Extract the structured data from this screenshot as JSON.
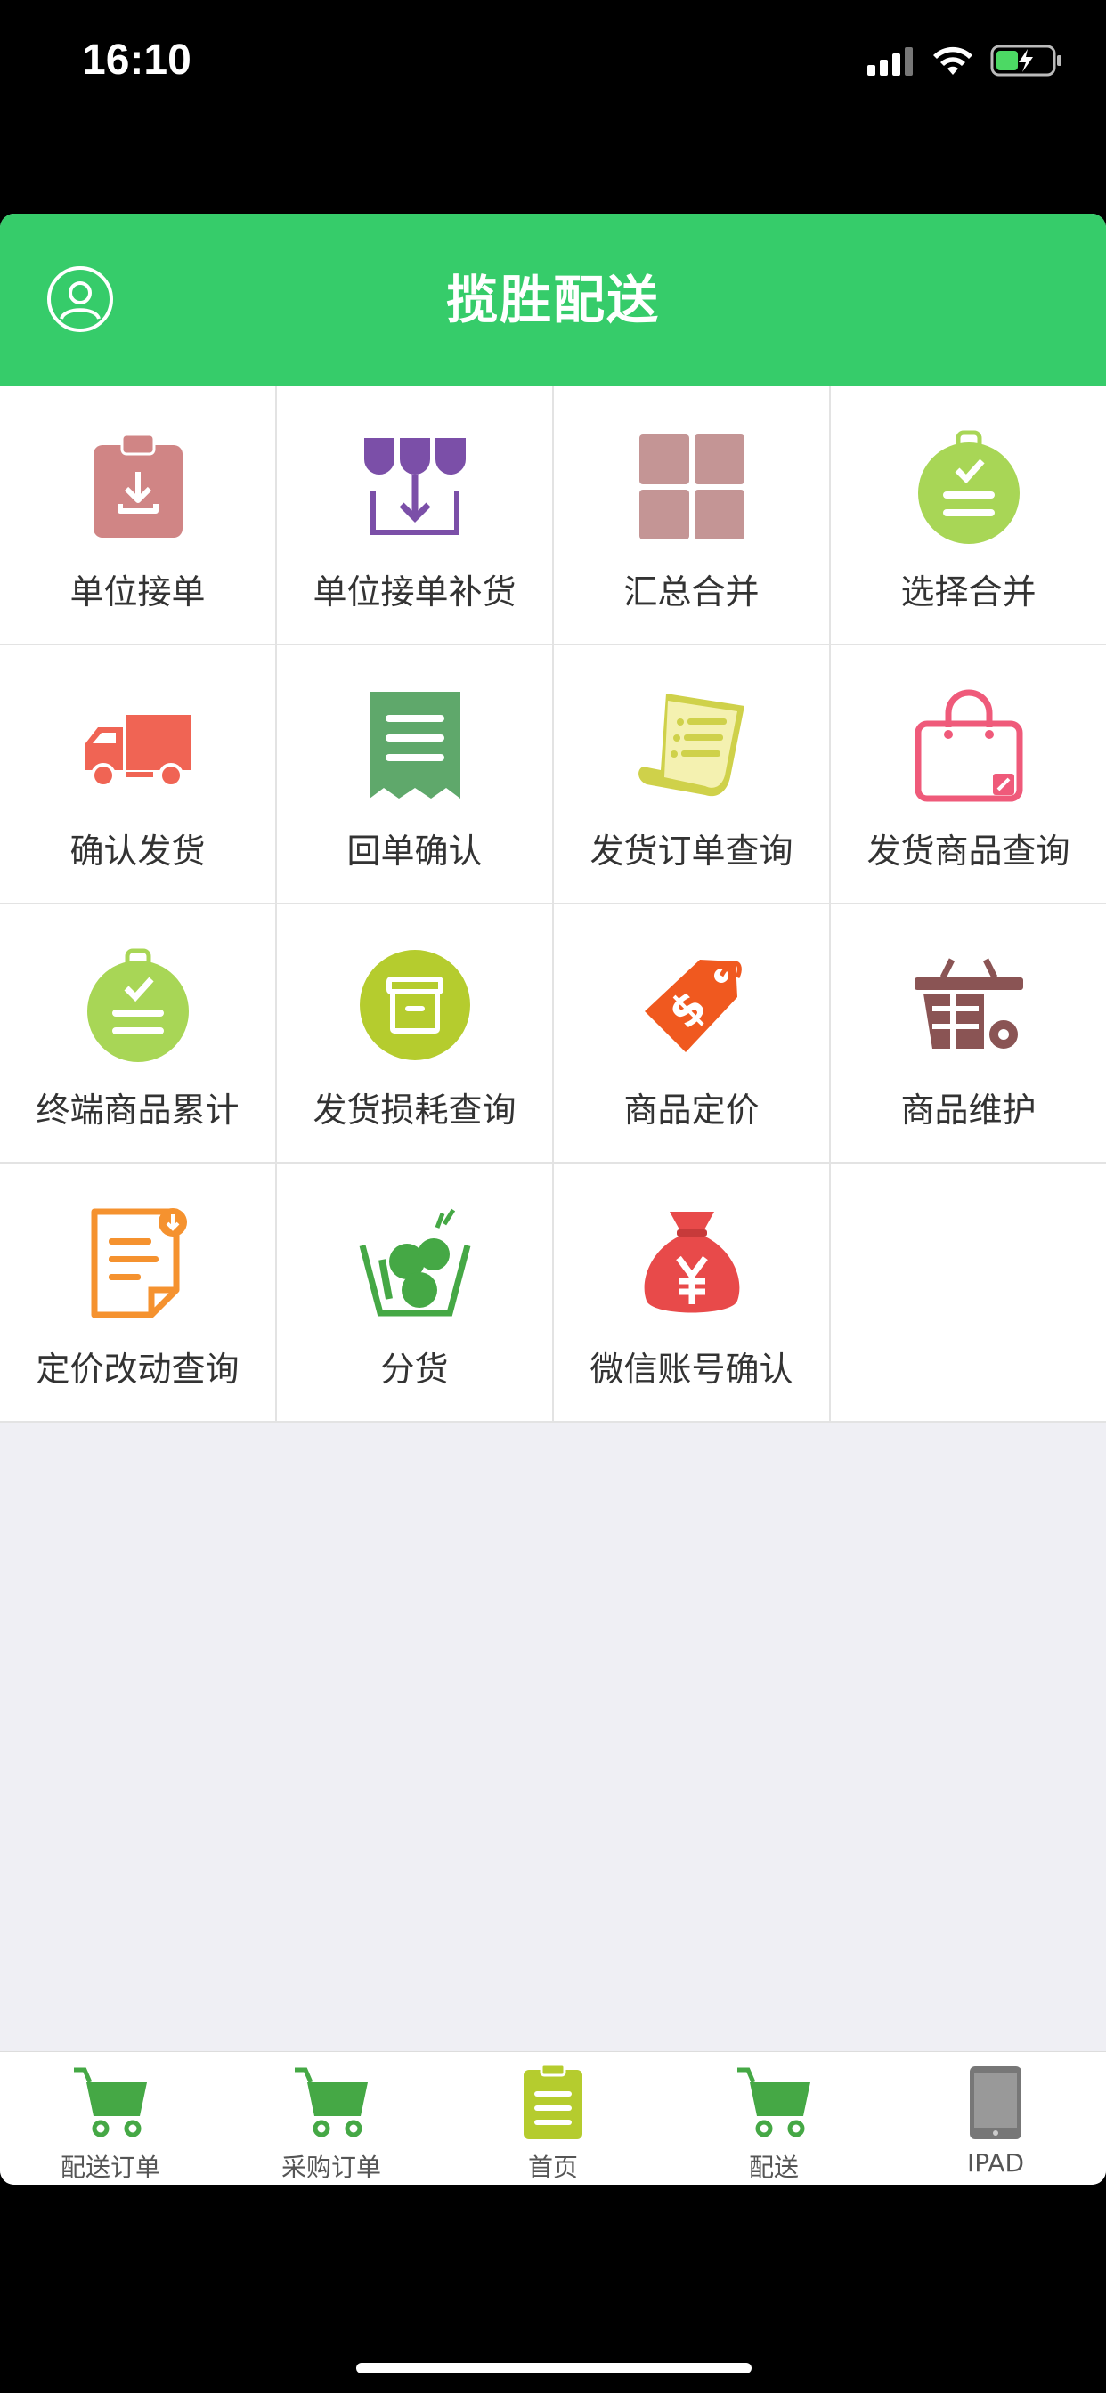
{
  "status_bar": {
    "time": "16:10"
  },
  "header": {
    "title": "揽胜配送"
  },
  "grid": [
    {
      "label": "单位接单",
      "icon": "clipboard-download-icon",
      "color": "#d08585"
    },
    {
      "label": "单位接单补货",
      "icon": "awning-arrow-down-icon",
      "color": "#7b4fa8"
    },
    {
      "label": "汇总合并",
      "icon": "four-squares-icon",
      "color": "#c49595"
    },
    {
      "label": "选择合并",
      "icon": "tag-check-icon",
      "color": "#a8d656"
    },
    {
      "label": "确认发货",
      "icon": "delivery-truck-icon",
      "color": "#f06454"
    },
    {
      "label": "回单确认",
      "icon": "receipt-icon",
      "color": "#5fa86b"
    },
    {
      "label": "发货订单查询",
      "icon": "scroll-list-icon",
      "color": "#cfd14a"
    },
    {
      "label": "发货商品查询",
      "icon": "shopping-bag-icon",
      "color": "#ef5a7a"
    },
    {
      "label": "终端商品累计",
      "icon": "tag-check-icon",
      "color": "#a8d656"
    },
    {
      "label": "发货损耗查询",
      "icon": "archive-box-icon",
      "color": "#b5cc2e"
    },
    {
      "label": "商品定价",
      "icon": "price-tag-icon",
      "color": "#f0591f"
    },
    {
      "label": "商品维护",
      "icon": "basket-gear-icon",
      "color": "#8a5454"
    },
    {
      "label": "定价改动查询",
      "icon": "document-edit-icon",
      "color": "#f5922f"
    },
    {
      "label": "分货",
      "icon": "vegetable-basket-icon",
      "color": "#45a845"
    },
    {
      "label": "微信账号确认",
      "icon": "money-bag-yen-icon",
      "color": "#e84a4a"
    }
  ],
  "tabs": [
    {
      "label": "配送订单",
      "icon": "cart-icon"
    },
    {
      "label": "采购订单",
      "icon": "cart-icon"
    },
    {
      "label": "首页",
      "icon": "clipboard-icon"
    },
    {
      "label": "配送",
      "icon": "cart-icon"
    },
    {
      "label": "IPAD",
      "icon": "tablet-icon"
    }
  ]
}
